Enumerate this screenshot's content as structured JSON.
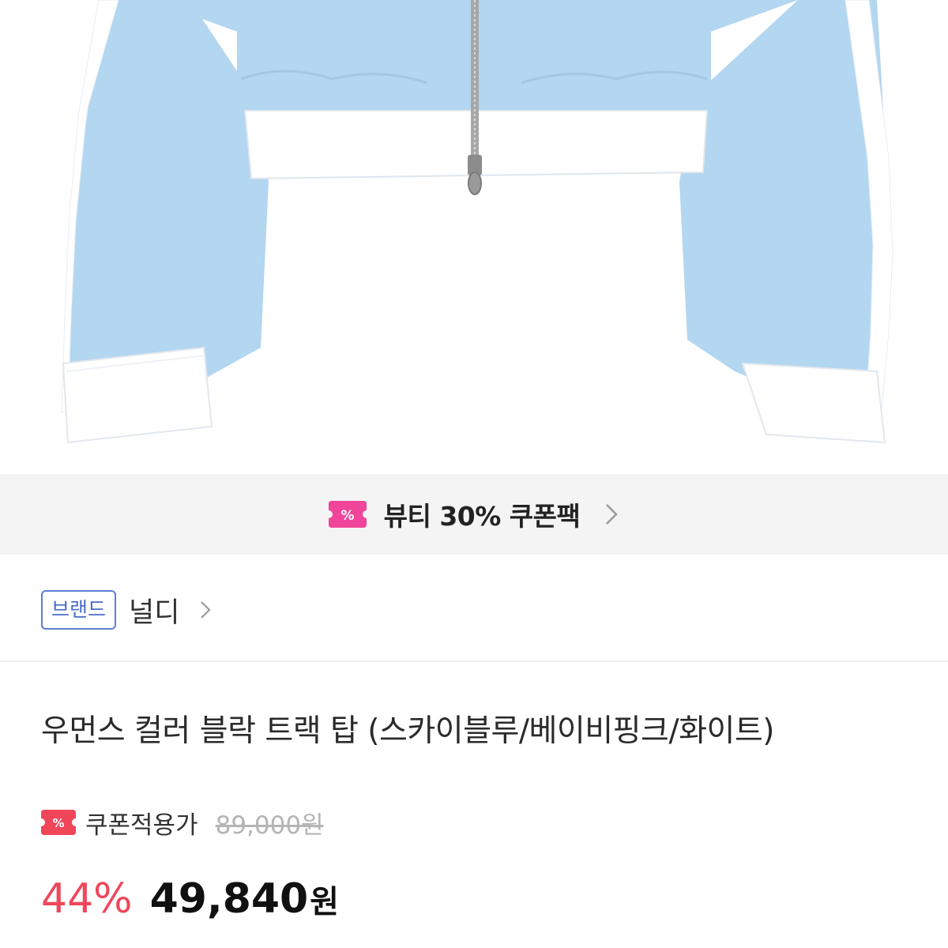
{
  "product_image": {
    "subject": "jacket-image",
    "colors": {
      "body": "#b3d6f1",
      "trim": "#ffffff",
      "zipper": "#9a9a9a"
    }
  },
  "coupon_banner": {
    "icon": "coupon-ticket-icon",
    "text": "뷰티 30% 쿠폰팩",
    "accent": "#f0459a"
  },
  "brand": {
    "badge_label": "브랜드",
    "name": "널디"
  },
  "product": {
    "title": "우먼스 컬러 블락 트랙 탑 (스카이블루/베이비핑크/화이트)",
    "coupon_label": "쿠폰적용가",
    "original_price": "89,000원",
    "discount": "44%",
    "price": "49,840",
    "currency": "원"
  },
  "colors": {
    "discount": "#f0465a",
    "badge_border": "#5b7fd6",
    "banner_bg": "#f4f4f4"
  }
}
